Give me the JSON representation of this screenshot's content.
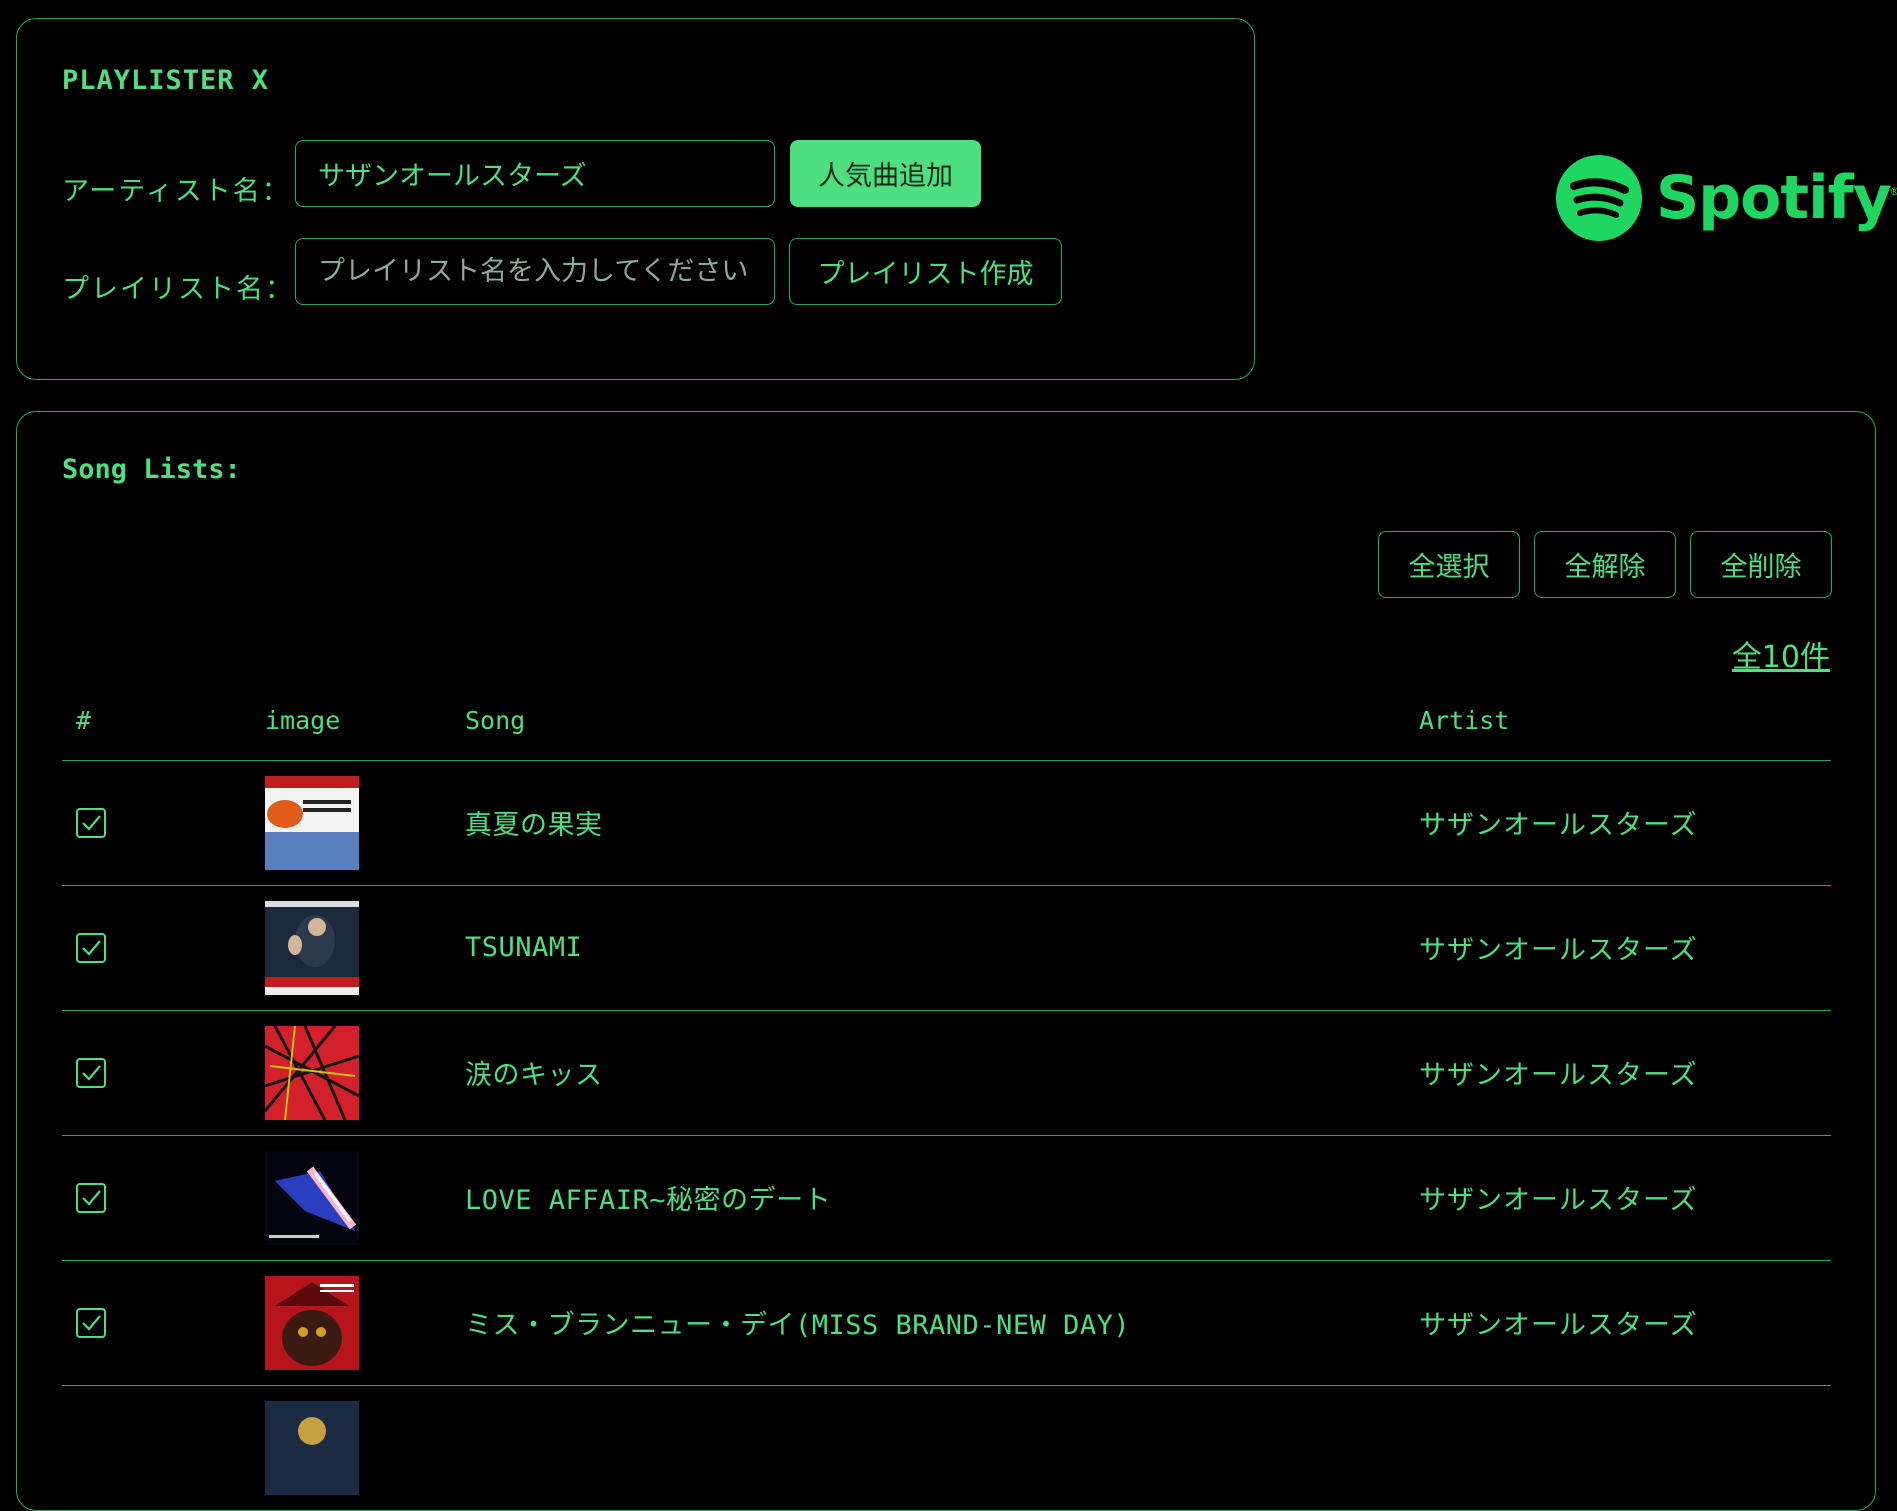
{
  "app": {
    "title": "PLAYLISTER X"
  },
  "form": {
    "artist_label": "アーティスト名：",
    "artist_value": "サザンオールスターズ",
    "add_popular_label": "人気曲追加",
    "playlist_label": "プレイリスト名：",
    "playlist_placeholder": "プレイリスト名を入力してください",
    "create_playlist_label": "プレイリスト作成"
  },
  "brand": {
    "name": "Spotify",
    "color": "#1ed760"
  },
  "song_list": {
    "title": "Song Lists:",
    "select_all": "全選択",
    "deselect_all": "全解除",
    "delete_all": "全削除",
    "count_label": "全10件",
    "columns": [
      "#",
      "image",
      "Song",
      "Artist"
    ],
    "rows": [
      {
        "checked": true,
        "song": "真夏の果実",
        "artist": "サザンオールスターズ",
        "cover": "album-cover"
      },
      {
        "checked": true,
        "song": "TSUNAMI",
        "artist": "サザンオールスターズ",
        "cover": "album-cover"
      },
      {
        "checked": true,
        "song": "涙のキッス",
        "artist": "サザンオールスターズ",
        "cover": "album-cover"
      },
      {
        "checked": true,
        "song": "LOVE AFFAIR~秘密のデート",
        "artist": "サザンオールスターズ",
        "cover": "album-cover"
      },
      {
        "checked": true,
        "song": "ミス・ブランニュー・デイ(MISS BRAND-NEW DAY)",
        "artist": "サザンオールスターズ",
        "cover": "album-cover"
      }
    ]
  },
  "colors": {
    "accent": "#4ddf80",
    "border": "#2aa85a",
    "background": "#000000"
  }
}
